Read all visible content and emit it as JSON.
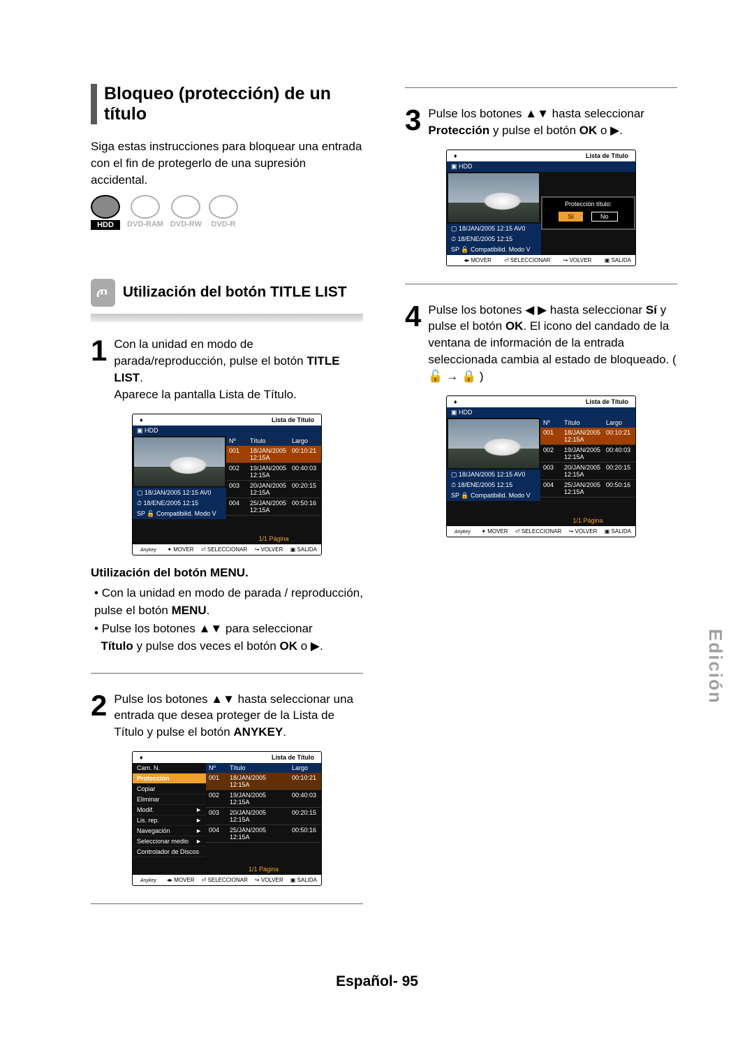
{
  "section_title": "Bloqueo (protección) de un título",
  "intro": "Siga estas instrucciones para bloquear una entrada con el fin de protegerlo de una supresión accidental.",
  "disc_icons": {
    "hdd": "HDD",
    "ram": "DVD-RAM",
    "rw": "DVD-RW",
    "r": "DVD-R"
  },
  "subtitle": "Utilización del botón TITLE LIST",
  "steps": {
    "s1": {
      "num": "1",
      "text_a": "Con la unidad en modo de parada/reproducción, pulse el botón ",
      "text_b": "TITLE LIST",
      "text_c": ".",
      "after": "Aparece la pantalla Lista de Título."
    },
    "s2": {
      "num": "2",
      "text_a": "Pulse los botones ▲▼ hasta seleccionar una entrada que desea proteger de la Lista de Título y pulse el botón ",
      "text_b": "ANYKEY",
      "text_c": "."
    },
    "s3": {
      "num": "3",
      "text_a": "Pulse los botones ▲▼ hasta seleccionar ",
      "text_b": "Protección",
      "text_c": " y pulse el botón ",
      "text_d": "OK",
      "text_e": " o ▶."
    },
    "s4": {
      "num": "4",
      "text_a": "Pulse los botones ◀ ▶ hasta seleccionar ",
      "text_b": "Sí",
      "text_c": " y pulse el botón ",
      "text_d": "OK",
      "text_e": ". El icono del candado de la ventana de información de la entrada seleccionada cambia al estado de bloqueado. ( 🔓 → 🔒 )"
    }
  },
  "menu_head": "Utilización del botón MENU.",
  "menu_bul": {
    "b1_a": "Con la unidad en modo de parada / reproducción, pulse el botón ",
    "b1_b": "MENU",
    "b1_c": ".",
    "b2": "Pulse los botones ▲▼ para seleccionar",
    "b3_a": "Título",
    "b3_b": " y pulse dos veces el botón ",
    "b3_c": "OK",
    "b3_d": " o ▶."
  },
  "tv": {
    "header": "Lista de Título",
    "hdd": "HDD",
    "cols": {
      "n": "Nº",
      "t": "Título",
      "l": "Largo"
    },
    "rows": [
      {
        "n": "001",
        "t": "18/JAN/2005 12:15A",
        "l": "00:10:21"
      },
      {
        "n": "002",
        "t": "19/JAN/2005 12:15A",
        "l": "00:40:03"
      },
      {
        "n": "003",
        "t": "20/JAN/2005 12:15A",
        "l": "00:20:15"
      },
      {
        "n": "004",
        "t": "25/JAN/2005 12:15A",
        "l": "00:50:16"
      }
    ],
    "info": {
      "l1": "18/JAN/2005 12:15 AV0",
      "l2": "18/ENE/2005 12:15",
      "l3": "SP 🔓 Compatibilid. Modo V",
      "l3b": "SP 🔒 Compatibilid. Modo V"
    },
    "page": "1/1  Página",
    "foot": {
      "any": "Anykey",
      "m": "MOVER",
      "s": "SELECCIONAR",
      "v": "VOLVER",
      "e": "SALIDA"
    },
    "foot2_m": "MOVER"
  },
  "tv_menu": {
    "items": [
      "Cam. N.",
      "Protección",
      "Copiar",
      "Eliminar",
      "Modif.",
      "Lis. rep.",
      "Navegación",
      "Seleccionar medio",
      "Controlador de Discos"
    ],
    "arrows": [
      4,
      5,
      6,
      7
    ]
  },
  "tv_protect": {
    "title": "Protección título:",
    "yes": "Sí",
    "no": "No"
  },
  "side_tab": "Edición",
  "footer_a": "Español- ",
  "footer_b": "95"
}
